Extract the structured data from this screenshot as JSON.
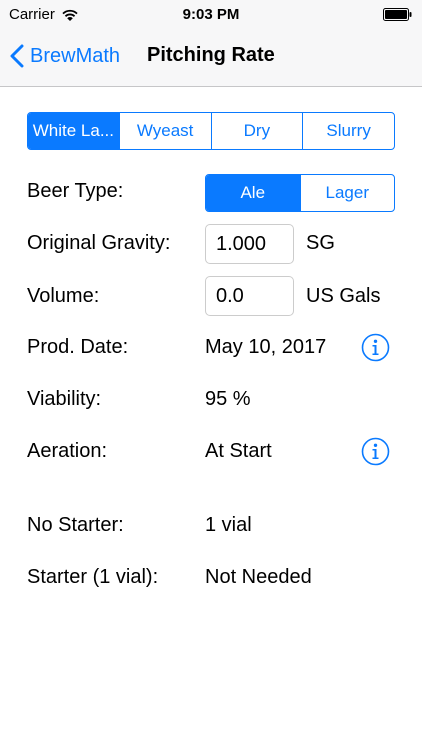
{
  "status_bar": {
    "carrier": "Carrier",
    "time": "9:03 PM"
  },
  "nav": {
    "back_label": "BrewMath",
    "title": "Pitching Rate"
  },
  "yeast_source": {
    "options": [
      "White La...",
      "Wyeast",
      "Dry",
      "Slurry"
    ],
    "selected_index": 0
  },
  "beer_type": {
    "label": "Beer Type:",
    "options": [
      "Ale",
      "Lager"
    ],
    "selected_index": 0
  },
  "original_gravity": {
    "label": "Original Gravity:",
    "value": "1.000",
    "unit": "SG"
  },
  "volume": {
    "label": "Volume:",
    "value": "0.0",
    "unit": "US Gals"
  },
  "prod_date": {
    "label": "Prod. Date:",
    "value": "May 10, 2017"
  },
  "viability": {
    "label": "Viability:",
    "value": "95 %"
  },
  "aeration": {
    "label": "Aeration:",
    "value": "At Start"
  },
  "no_starter": {
    "label": "No Starter:",
    "value": "1 vial"
  },
  "starter": {
    "label": "Starter (1 vial):",
    "value": "Not Needed"
  },
  "colors": {
    "accent": "#0a7aff",
    "bar_background": "#f7f7f8"
  },
  "icons": {
    "back": "chevron-left-icon",
    "info": "info-icon",
    "wifi": "wifi-icon",
    "battery": "battery-icon"
  }
}
